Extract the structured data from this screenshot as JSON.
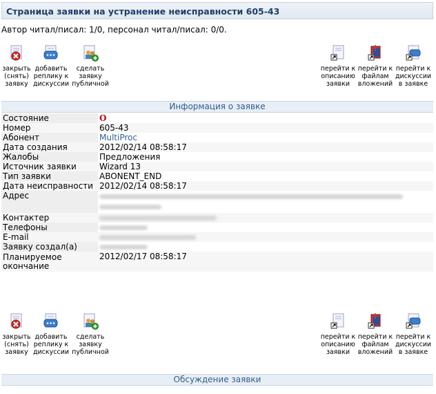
{
  "page": {
    "title": "Страница заявки на устранение неисправности 605-43",
    "author_line": "Автор читал/писал: 1/0, персонал читал/писал: 0/0."
  },
  "toolbar": {
    "close": "закрыть (снять) заявку",
    "add_reply": "добавить реплику к дискуссии",
    "make_public": "сделать заявку публичной",
    "go_description": "перейти к описанию заявки",
    "go_files": "перейти к файлам вложений",
    "go_discussion": "перейти к дискуссии в заявке"
  },
  "info": {
    "header": "Информация о заявке",
    "rows": [
      {
        "label": "Состояние",
        "value": "О"
      },
      {
        "label": "Номер",
        "value": "605-43"
      },
      {
        "label": "Абонент",
        "value": "MultiProc"
      },
      {
        "label": "Дата создания",
        "value": "2012/02/14 08:58:17"
      },
      {
        "label": "Жалобы",
        "value": "Предложения"
      },
      {
        "label": "Источник заявки",
        "value": "Wizard 13"
      },
      {
        "label": "Тип заявки",
        "value": "ABONENT_END"
      },
      {
        "label": "Дата неисправности",
        "value": "2012/02/14 08:58:17"
      },
      {
        "label": "Адрес",
        "value": ""
      },
      {
        "label": "Контактер",
        "value": ""
      },
      {
        "label": "Телефоны",
        "value": ""
      },
      {
        "label": "E-mail",
        "value": ""
      },
      {
        "label": "Заявку создал(а)",
        "value": ""
      },
      {
        "label": "Планируемое окончание",
        "value": "2012/02/17 08:58:17"
      }
    ]
  },
  "discussion": {
    "header": "Обсуждение заявки"
  },
  "colors": {
    "title": "#1f3f66",
    "link": "#2f5f8f",
    "status": "#c00000"
  }
}
